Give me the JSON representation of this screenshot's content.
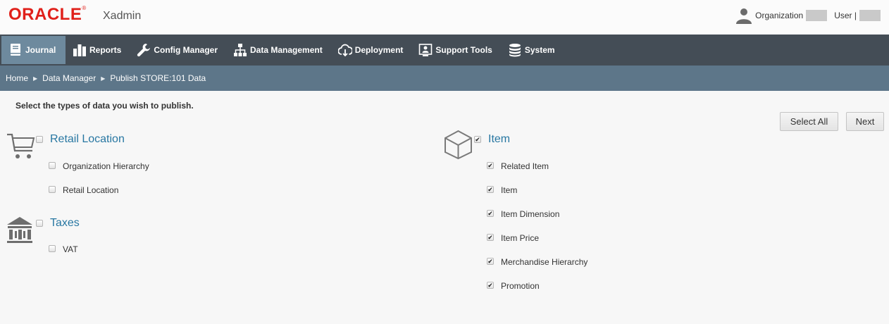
{
  "header": {
    "logo": "ORACLE",
    "trademark": "®",
    "app_name": "Xadmin",
    "org_label": "Organization",
    "user_label": "User |"
  },
  "nav": {
    "items": [
      {
        "label": "Journal",
        "icon": "journal-icon",
        "active": true
      },
      {
        "label": "Reports",
        "icon": "bar-chart-icon",
        "active": false
      },
      {
        "label": "Config Manager",
        "icon": "wrench-icon",
        "active": false
      },
      {
        "label": "Data Management",
        "icon": "hierarchy-icon",
        "active": false
      },
      {
        "label": "Deployment",
        "icon": "cloud-download-icon",
        "active": false
      },
      {
        "label": "Support Tools",
        "icon": "support-icon",
        "active": false
      },
      {
        "label": "System",
        "icon": "database-icon",
        "active": false
      }
    ]
  },
  "breadcrumb": {
    "items": [
      "Home",
      "Data Manager",
      "Publish STORE:101 Data"
    ],
    "separator": "▶"
  },
  "main": {
    "instruction": "Select the types of data you wish to publish.",
    "select_all_label": "Select All",
    "next_label": "Next",
    "groups": [
      {
        "title": "Retail Location",
        "icon": "cart-icon",
        "checked": false,
        "items": [
          {
            "label": "Organization Hierarchy",
            "checked": false
          },
          {
            "label": "Retail Location",
            "checked": false
          }
        ]
      },
      {
        "title": "Taxes",
        "icon": "bank-icon",
        "checked": false,
        "items": [
          {
            "label": "VAT",
            "checked": false
          }
        ]
      },
      {
        "title": "Item",
        "icon": "box-icon",
        "checked": true,
        "items": [
          {
            "label": "Related Item",
            "checked": true
          },
          {
            "label": "Item",
            "checked": true
          },
          {
            "label": "Item Dimension",
            "checked": true
          },
          {
            "label": "Item Price",
            "checked": true
          },
          {
            "label": "Merchandise Hierarchy",
            "checked": true
          },
          {
            "label": "Promotion",
            "checked": true
          }
        ]
      }
    ]
  },
  "colors": {
    "brand": "#e0201a",
    "nav_bg": "#444d56",
    "nav_active": "#6e8a9e",
    "breadcrumb_bg": "#5d7689",
    "group_title": "#2877a2"
  }
}
